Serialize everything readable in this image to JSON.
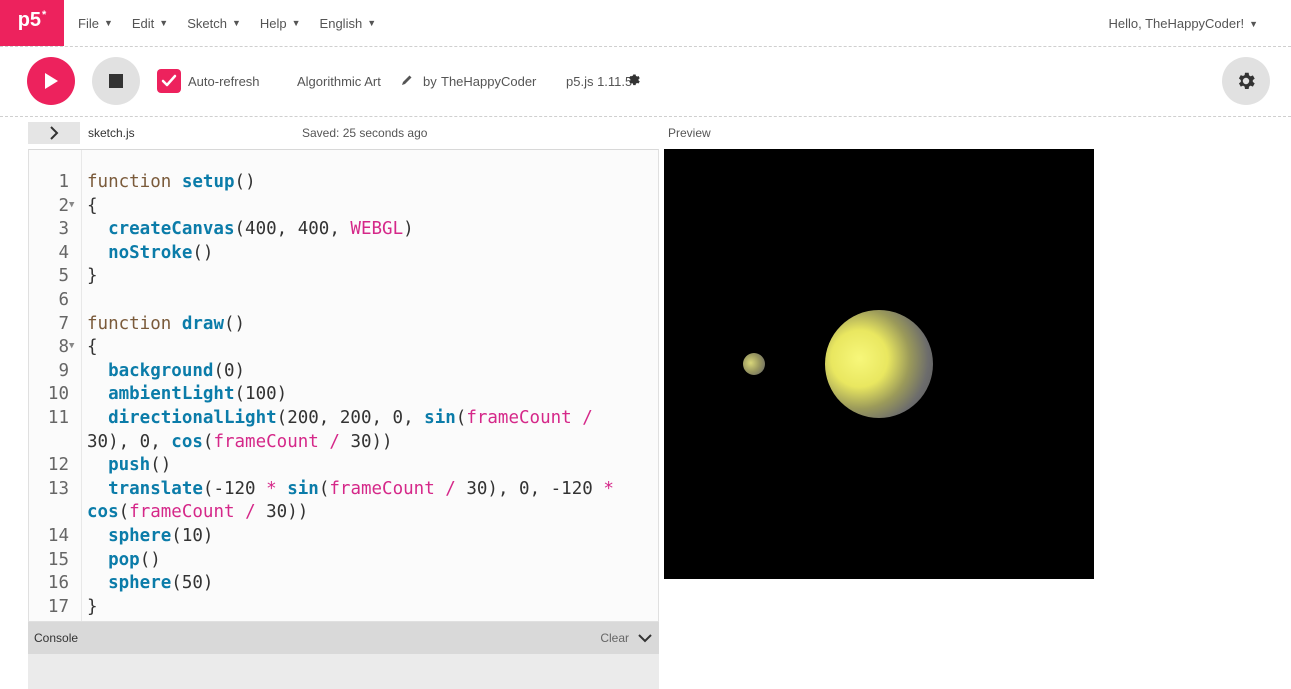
{
  "menubar": {
    "logo": "p5",
    "logo_sup": "*",
    "items": [
      {
        "label": "File"
      },
      {
        "label": "Edit"
      },
      {
        "label": "Sketch"
      },
      {
        "label": "Help"
      },
      {
        "label": "English"
      }
    ],
    "user_greeting": "Hello, TheHappyCoder!"
  },
  "toolbar": {
    "auto_refresh_label": "Auto-refresh",
    "auto_refresh_checked": true,
    "sketch_title": "Algorithmic Art",
    "by_label": "by",
    "author": "TheHappyCoder",
    "version": "p5.js 1.11.5"
  },
  "editor": {
    "file_name": "sketch.js",
    "saved_status": "Saved: 25 seconds ago",
    "line_numbers": [
      "1",
      "2",
      "3",
      "4",
      "5",
      "6",
      "7",
      "8",
      "9",
      "10",
      "11",
      "",
      "12",
      "13",
      "",
      "14",
      "15",
      "16",
      "17"
    ]
  },
  "preview": {
    "label": "Preview"
  },
  "console": {
    "title": "Console",
    "clear_label": "Clear"
  },
  "colors": {
    "accent": "#ed225d",
    "keyword": "#7a5a3a",
    "function": "#0b7ca9",
    "constant": "#d52889"
  }
}
